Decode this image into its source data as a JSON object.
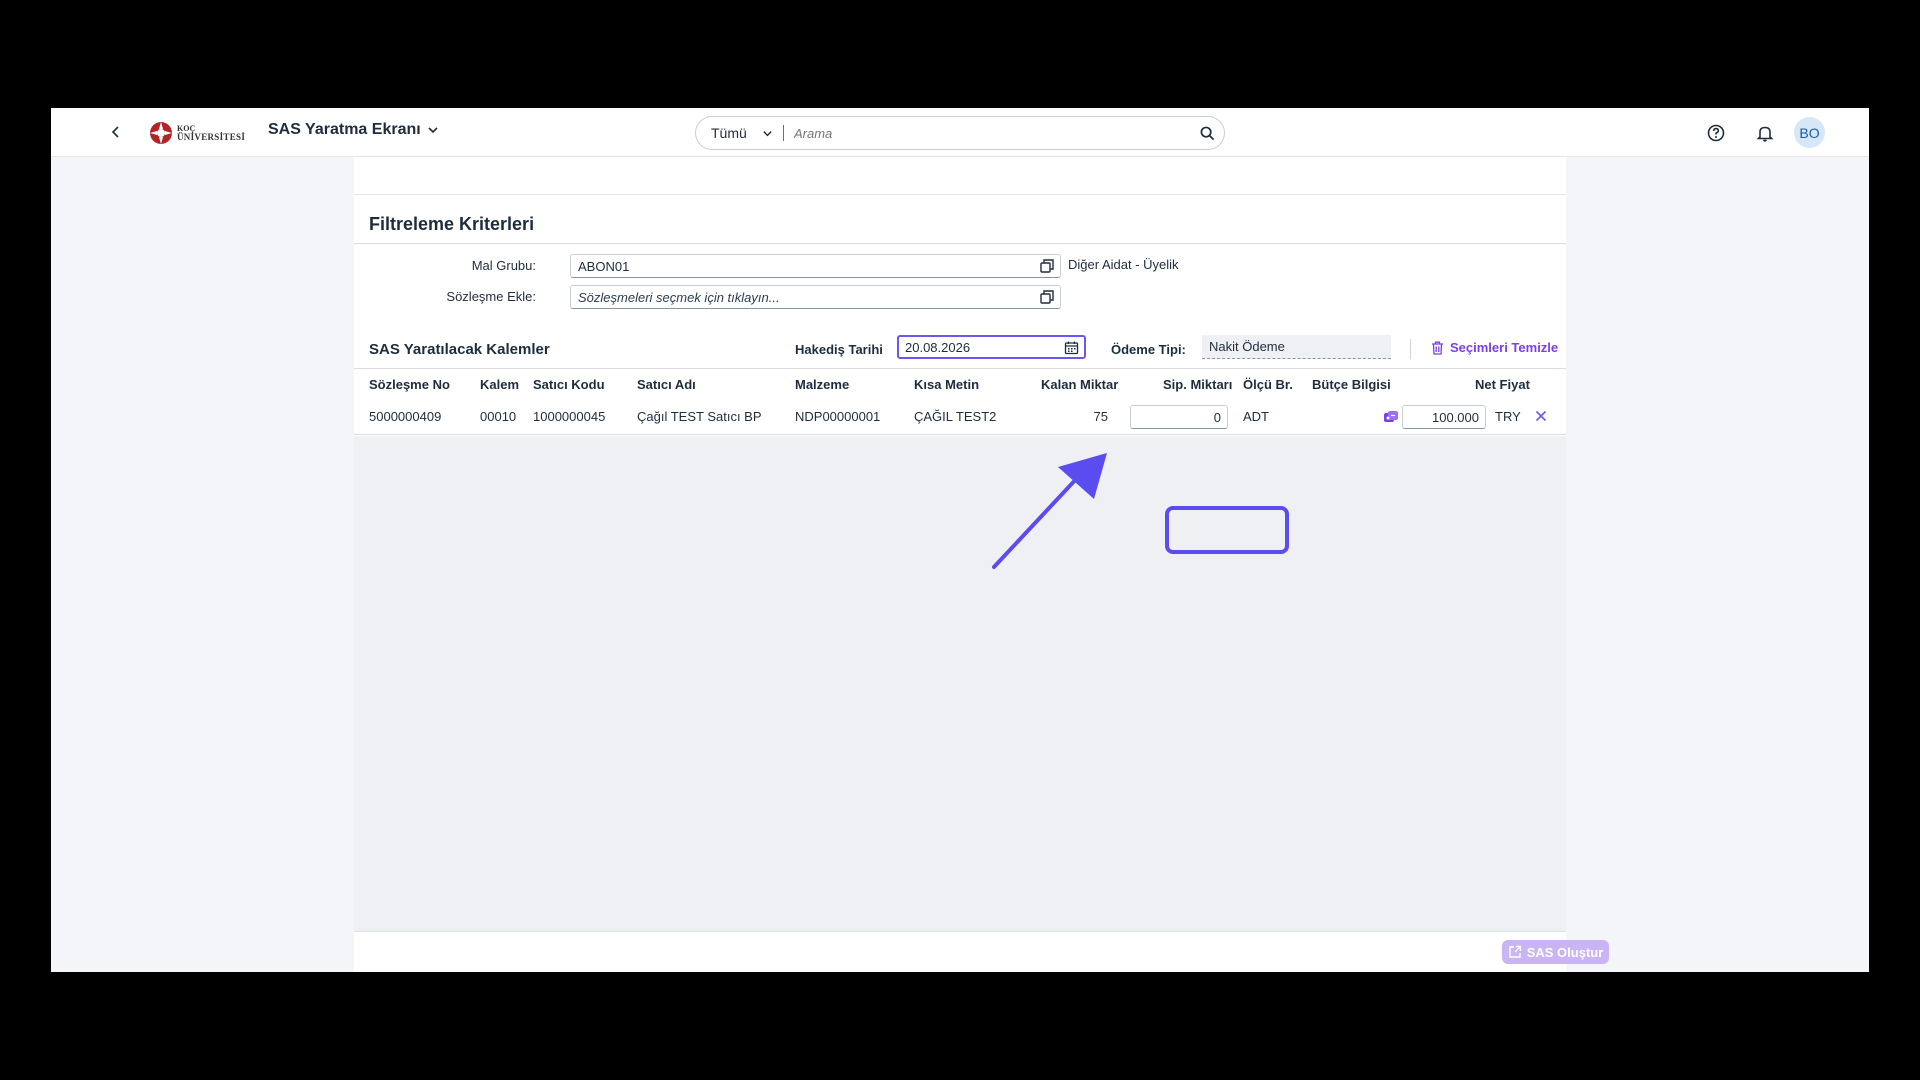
{
  "shell": {
    "logo_line1": "KOÇ",
    "logo_line2": "ÜNİVERSİTESİ",
    "app_title": "SAS Yaratma Ekranı",
    "search_scope": "Tümü",
    "search_placeholder": "Arama",
    "avatar_initials": "BO"
  },
  "filters": {
    "title": "Filtreleme Kriterleri",
    "mal_grubu_label": "Mal Grubu:",
    "mal_grubu_value": "ABON01",
    "mal_grubu_desc": "Diğer Aidat - Üyelik",
    "sozlesme_label": "Sözleşme Ekle:",
    "sozlesme_placeholder": "Sözleşmeleri seçmek için tıklayın..."
  },
  "items_table": {
    "title": "SAS Yaratılacak Kalemler",
    "hakedis_label": "Hakediş Tarihi",
    "hakedis_value": "20.08.2026",
    "odeme_label": "Ödeme Tipi:",
    "odeme_value": "Nakit Ödeme",
    "clear_label": "Seçimleri Temizle",
    "columns": [
      "Sözleşme No",
      "Kalem",
      "Satıcı Kodu",
      "Satıcı Adı",
      "Malzeme",
      "Kısa Metin",
      "Kalan Miktar",
      "Sip. Miktarı",
      "Ölçü Br.",
      "Bütçe Bilgisi",
      "Net Fiyat"
    ],
    "rows": [
      {
        "sozlesme_no": "5000000409",
        "kalem": "00010",
        "satici_kodu": "1000000045",
        "satici_adi": "Çağıl TEST Satıcı BP",
        "malzeme": "NDP00000001",
        "kisa_metin": "ÇAĞIL TEST2",
        "kalan_miktar": "75",
        "sip_miktari": "0",
        "olcu_br": "ADT",
        "net_fiyat": "100.000",
        "currency": "TRY"
      }
    ]
  },
  "footer": {
    "create_label": "SAS Oluştur"
  },
  "colors": {
    "accent": "#7b3fe4",
    "highlight": "#5b4cf0",
    "create_button": "#c9b4f5"
  },
  "icons": [
    "back-icon",
    "logo-icon",
    "chevron-down-icon",
    "search-icon",
    "help-icon",
    "bell-icon",
    "value-help-icon",
    "calendar-icon",
    "trash-icon",
    "budget-icon",
    "close-icon",
    "share-icon"
  ]
}
